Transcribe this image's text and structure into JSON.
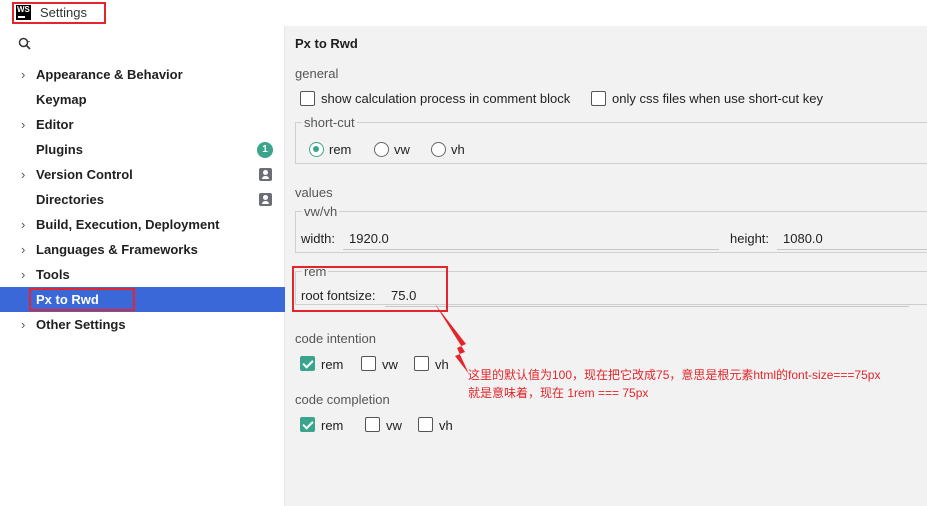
{
  "window": {
    "title": "Settings",
    "logo_text": "WS"
  },
  "sidebar": {
    "items": [
      {
        "label": "Appearance & Behavior",
        "expandable": true
      },
      {
        "label": "Keymap",
        "expandable": false
      },
      {
        "label": "Editor",
        "expandable": true
      },
      {
        "label": "Plugins",
        "expandable": false,
        "badge": "1"
      },
      {
        "label": "Version Control",
        "expandable": true,
        "icon": "project-icon"
      },
      {
        "label": "Directories",
        "expandable": false,
        "icon": "project-icon"
      },
      {
        "label": "Build, Execution, Deployment",
        "expandable": true
      },
      {
        "label": "Languages & Frameworks",
        "expandable": true
      },
      {
        "label": "Tools",
        "expandable": true
      },
      {
        "label": "Px to Rwd",
        "expandable": false,
        "selected": true
      },
      {
        "label": "Other Settings",
        "expandable": true
      }
    ],
    "chevron": "›"
  },
  "page": {
    "title": "Px to Rwd",
    "general": {
      "label": "general",
      "show_calc": {
        "label": "show calculation process in comment block",
        "checked": false
      },
      "only_css": {
        "label": "only css files when use short-cut key",
        "checked": false
      }
    },
    "shortcut": {
      "label": "short-cut",
      "options": [
        {
          "label": "rem",
          "checked": true
        },
        {
          "label": "vw",
          "checked": false
        },
        {
          "label": "vh",
          "checked": false
        }
      ]
    },
    "values": {
      "label": "values",
      "vwvh_label": "vw/vh",
      "width_label": "width:",
      "width_value": "1920.0",
      "height_label": "height:",
      "height_value": "1080.0",
      "rem_label": "rem",
      "root_label": "root fontsize:",
      "root_value": "75.0"
    },
    "code_intention": {
      "label": "code intention",
      "options": [
        {
          "label": "rem",
          "checked": true
        },
        {
          "label": "vw",
          "checked": false
        },
        {
          "label": "vh",
          "checked": false
        }
      ]
    },
    "code_completion": {
      "label": "code completion",
      "options": [
        {
          "label": "rem",
          "checked": true
        },
        {
          "label": "vw",
          "checked": false
        },
        {
          "label": "vh",
          "checked": false
        }
      ]
    }
  },
  "annotation": {
    "line1": "这里的默认值为100，现在把它改成75，意思是根元素html的font-size===75px",
    "line2": "就是意味着，现在 1rem === 75px"
  },
  "colors": {
    "accent": "#3aa58c",
    "selection": "#3b68d8",
    "annotation_red": "#e2262b"
  }
}
